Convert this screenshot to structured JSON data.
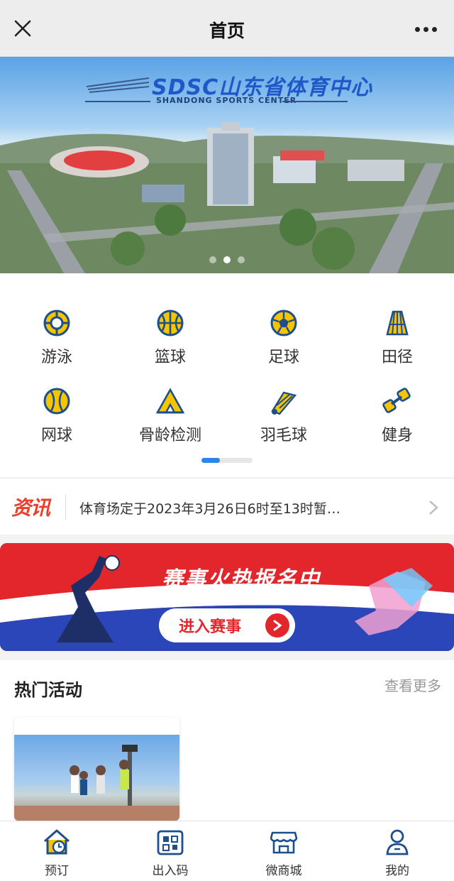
{
  "header": {
    "title": "首页"
  },
  "banner": {
    "logo": "SDSC山东省体育中心",
    "logo_sub": "SHANDONG SPORTS CENTER",
    "slides": 3,
    "active_slide": 1
  },
  "categories": [
    {
      "label": "游泳",
      "icon": "swimming-icon"
    },
    {
      "label": "篮球",
      "icon": "basketball-icon"
    },
    {
      "label": "足球",
      "icon": "football-icon"
    },
    {
      "label": "田径",
      "icon": "track-icon"
    },
    {
      "label": "网球",
      "icon": "tennis-icon"
    },
    {
      "label": "骨龄检测",
      "icon": "tent-icon"
    },
    {
      "label": "羽毛球",
      "icon": "badminton-icon"
    },
    {
      "label": "健身",
      "icon": "dumbbell-icon"
    }
  ],
  "news": {
    "tag": "资讯",
    "text": "体育场定于2023年3月26日6时至13时暂…"
  },
  "event": {
    "title": "赛事火热报名中",
    "cta": "进入赛事"
  },
  "hot": {
    "title": "热门活动",
    "more": "查看更多"
  },
  "tabbar": [
    {
      "label": "预订",
      "icon": "booking-icon"
    },
    {
      "label": "出入码",
      "icon": "qr-code-icon"
    },
    {
      "label": "微商城",
      "icon": "store-icon"
    },
    {
      "label": "我的",
      "icon": "profile-icon"
    }
  ],
  "colors": {
    "accent": "#2b86e8",
    "icon_yellow": "#f6c400",
    "icon_blue": "#1c4f8c",
    "event_red": "#e3262c"
  }
}
